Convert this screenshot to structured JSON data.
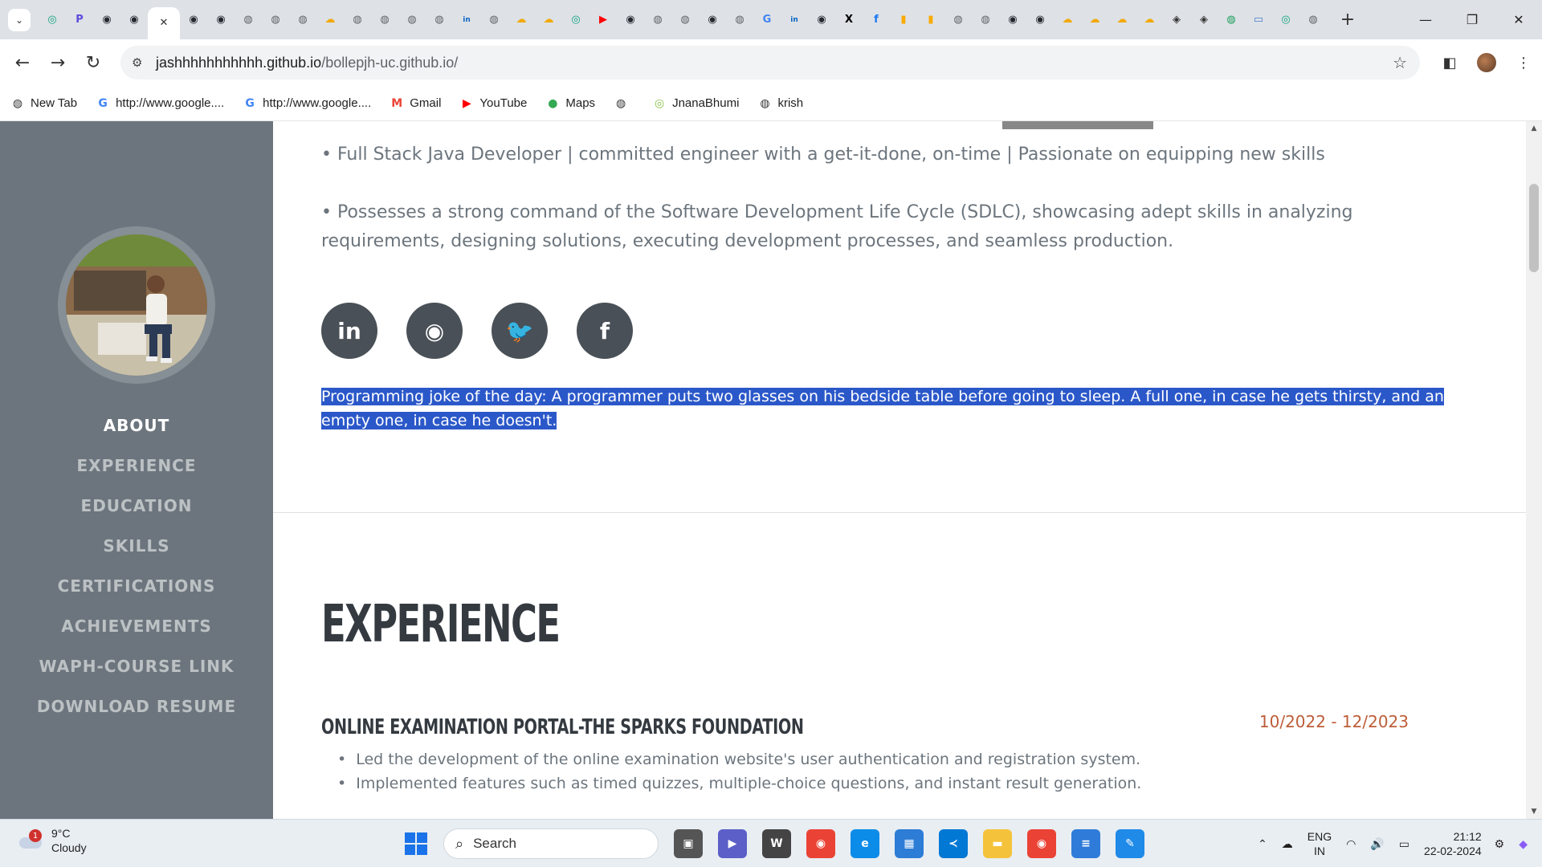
{
  "browser": {
    "tabs": [
      {
        "icon": "chatgpt-icon",
        "color": "#10a37f",
        "glyph": "◎"
      },
      {
        "icon": "perplexity-icon",
        "color": "#5b4cdb",
        "glyph": "P"
      },
      {
        "icon": "github-icon",
        "color": "#24292f",
        "glyph": "◉"
      },
      {
        "icon": "github-icon",
        "color": "#24292f",
        "glyph": "◉"
      },
      {
        "icon": "close-tab-icon",
        "color": "#333333",
        "glyph": "✕",
        "active": true
      },
      {
        "icon": "github-icon",
        "color": "#24292f",
        "glyph": "◉"
      },
      {
        "icon": "github-icon",
        "color": "#24292f",
        "glyph": "◉"
      },
      {
        "icon": "globe-icon",
        "color": "#5f6368",
        "glyph": "◍"
      },
      {
        "icon": "globe-icon",
        "color": "#5f6368",
        "glyph": "◍"
      },
      {
        "icon": "globe-icon",
        "color": "#5f6368",
        "glyph": "◍"
      },
      {
        "icon": "weather-icon",
        "color": "#f2a900",
        "glyph": "☁"
      },
      {
        "icon": "globe-icon",
        "color": "#5f6368",
        "glyph": "◍"
      },
      {
        "icon": "globe-icon",
        "color": "#5f6368",
        "glyph": "◍"
      },
      {
        "icon": "globe-icon",
        "color": "#5f6368",
        "glyph": "◍"
      },
      {
        "icon": "globe-icon",
        "color": "#5f6368",
        "glyph": "◍"
      },
      {
        "icon": "linkedin-icon",
        "color": "#0a66c2",
        "glyph": "in"
      },
      {
        "icon": "globe-icon",
        "color": "#5f6368",
        "glyph": "◍"
      },
      {
        "icon": "weather-icon",
        "color": "#f2a900",
        "glyph": "☁"
      },
      {
        "icon": "weather-icon",
        "color": "#f2a900",
        "glyph": "☁"
      },
      {
        "icon": "chatgpt-icon",
        "color": "#10a37f",
        "glyph": "◎"
      },
      {
        "icon": "youtube-icon",
        "color": "#ff0000",
        "glyph": "▶"
      },
      {
        "icon": "github-icon",
        "color": "#24292f",
        "glyph": "◉"
      },
      {
        "icon": "globe-icon",
        "color": "#5f6368",
        "glyph": "◍"
      },
      {
        "icon": "globe-icon",
        "color": "#5f6368",
        "glyph": "◍"
      },
      {
        "icon": "github-icon",
        "color": "#24292f",
        "glyph": "◉"
      },
      {
        "icon": "globe-icon",
        "color": "#5f6368",
        "glyph": "◍"
      },
      {
        "icon": "google-icon",
        "color": "#4285f4",
        "glyph": "G"
      },
      {
        "icon": "linkedin-icon",
        "color": "#0a66c2",
        "glyph": "in"
      },
      {
        "icon": "github-icon",
        "color": "#24292f",
        "glyph": "◉"
      },
      {
        "icon": "x-icon",
        "color": "#000000",
        "glyph": "X"
      },
      {
        "icon": "facebook-icon",
        "color": "#1877f2",
        "glyph": "f"
      },
      {
        "icon": "analytics-icon",
        "color": "#f9ab00",
        "glyph": "▮"
      },
      {
        "icon": "analytics-icon",
        "color": "#f9ab00",
        "glyph": "▮"
      },
      {
        "icon": "globe-icon",
        "color": "#5f6368",
        "glyph": "◍"
      },
      {
        "icon": "globe-icon",
        "color": "#5f6368",
        "glyph": "◍"
      },
      {
        "icon": "github-icon",
        "color": "#24292f",
        "glyph": "◉"
      },
      {
        "icon": "github-icon",
        "color": "#24292f",
        "glyph": "◉"
      },
      {
        "icon": "weather-icon",
        "color": "#f2a900",
        "glyph": "☁"
      },
      {
        "icon": "weather-icon",
        "color": "#f2a900",
        "glyph": "☁"
      },
      {
        "icon": "weather-icon",
        "color": "#f2a900",
        "glyph": "☁"
      },
      {
        "icon": "weather-icon",
        "color": "#f2a900",
        "glyph": "☁"
      },
      {
        "icon": "openai-icon",
        "color": "#333333",
        "glyph": "◈"
      },
      {
        "icon": "openai-icon",
        "color": "#333333",
        "glyph": "◈"
      },
      {
        "icon": "world-icon",
        "color": "#1a9e5a",
        "glyph": "◍"
      },
      {
        "icon": "monitor-icon",
        "color": "#4a7bd0",
        "glyph": "▭"
      },
      {
        "icon": "chatgpt-icon",
        "color": "#10a37f",
        "glyph": "◎"
      },
      {
        "icon": "globe-icon",
        "color": "#5f6368",
        "glyph": "◍"
      }
    ],
    "url_host": "jashhhhhhhhhhh.github.io",
    "url_path": "/bollepjh-uc.github.io/",
    "bookmarks": [
      {
        "label": "New Tab",
        "icon": "globe-icon",
        "color": "#333333",
        "glyph": "◍"
      },
      {
        "label": "http://www.google....",
        "icon": "google-icon",
        "color": "#4285f4",
        "glyph": "G"
      },
      {
        "label": "http://www.google....",
        "icon": "google-icon",
        "color": "#4285f4",
        "glyph": "G"
      },
      {
        "label": "Gmail",
        "icon": "gmail-icon",
        "color": "#ea4335",
        "glyph": "M"
      },
      {
        "label": "YouTube",
        "icon": "youtube-icon",
        "color": "#ff0000",
        "glyph": "▶"
      },
      {
        "label": "Maps",
        "icon": "maps-icon",
        "color": "#34a853",
        "glyph": "●"
      },
      {
        "label": "",
        "icon": "globe-icon",
        "color": "#333333",
        "glyph": "◍"
      },
      {
        "label": "JnanaBhumi",
        "icon": "jnanabhumi-icon",
        "color": "#8bc34a",
        "glyph": "◎"
      },
      {
        "label": "krish",
        "icon": "globe-icon",
        "color": "#333333",
        "glyph": "◍"
      }
    ]
  },
  "sidebar": {
    "items": [
      {
        "label": "ABOUT",
        "active": true
      },
      {
        "label": "EXPERIENCE"
      },
      {
        "label": "EDUCATION"
      },
      {
        "label": "SKILLS"
      },
      {
        "label": "CERTIFICATIONS"
      },
      {
        "label": "ACHIEVEMENTS"
      },
      {
        "label": "WAPH-COURSE LINK"
      },
      {
        "label": "DOWNLOAD RESUME"
      }
    ]
  },
  "about": {
    "bullet1": "• Full Stack Java Developer | committed engineer with a get-it-done, on-time | Passionate on equipping new skills",
    "bullet2": "• Possesses a strong command of the Software Development Life Cycle (SDLC), showcasing adept skills in analyzing requirements, designing solutions, executing development processes, and seamless production.",
    "social": [
      {
        "icon": "linkedin-icon",
        "glyph": "in"
      },
      {
        "icon": "github-icon",
        "glyph": "◉"
      },
      {
        "icon": "twitter-icon",
        "glyph": "🐦"
      },
      {
        "icon": "facebook-icon",
        "glyph": "f"
      }
    ],
    "joke": "Programming joke of the day: A programmer puts two glasses on his bedside table before going to sleep. A full one, in case he gets thirsty, and an empty one, in case he doesn't."
  },
  "experience": {
    "title": "EXPERIENCE",
    "job_title": "ONLINE EXAMINATION PORTAL-THE SPARKS FOUNDATION",
    "job_date": "10/2022 - 12/2023",
    "bullets": [
      "Led the development of the online examination website's user authentication and registration system.",
      "Implemented features such as timed quizzes, multiple-choice questions, and instant result generation."
    ]
  },
  "taskbar": {
    "weather_badge": "1",
    "weather_temp": "9°C",
    "weather_desc": "Cloudy",
    "search_label": "Search",
    "apps": [
      {
        "icon": "task-view-icon",
        "color": "#555555",
        "glyph": "▣"
      },
      {
        "icon": "teams-icon",
        "color": "#5b5fc7",
        "glyph": "▶"
      },
      {
        "icon": "wacom-icon",
        "color": "#444444",
        "glyph": "W"
      },
      {
        "icon": "chrome-icon",
        "color": "#ea4335",
        "glyph": "◉"
      },
      {
        "icon": "edge-icon",
        "color": "#0c8ce9",
        "glyph": "e"
      },
      {
        "icon": "store-icon",
        "color": "#2d7cd6",
        "glyph": "▦"
      },
      {
        "icon": "vscode-icon",
        "color": "#0078d4",
        "glyph": "≺"
      },
      {
        "icon": "file-explorer-icon",
        "color": "#f5c33b",
        "glyph": "▬"
      },
      {
        "icon": "chrome-icon",
        "color": "#ea4335",
        "glyph": "◉"
      },
      {
        "icon": "notepad-icon",
        "color": "#2f7bd9",
        "glyph": "≡"
      },
      {
        "icon": "paint-icon",
        "color": "#1f8ae8",
        "glyph": "✎"
      }
    ],
    "lang_top": "ENG",
    "lang_bottom": "IN",
    "time": "21:12",
    "date": "22-02-2024"
  }
}
